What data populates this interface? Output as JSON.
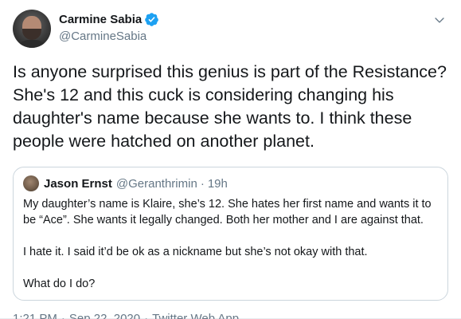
{
  "tweet": {
    "author": {
      "display_name": "Carmine Sabia",
      "handle": "@CarmineSabia",
      "verified": true,
      "verified_color": "#1da1f2"
    },
    "text": "Is anyone surprised this genius is part of the Resistance? She's 12 and this cuck is considering changing his daughter's name because she wants to. I think these people were hatched on another planet.",
    "quoted": {
      "display_name": "Jason Ernst",
      "handle": "@Geranthrimin",
      "dot": "·",
      "time": "19h",
      "paragraphs": [
        "My daughter’s name is Klaire, she’s 12. She hates her first name and wants it to be “Ace”. She wants it legally changed. Both her mother and I are against that.",
        "I hate it. I said it’d be ok as a nickname but she’s not okay with that.",
        "What do I do?"
      ]
    },
    "meta": {
      "time": "1:21 PM",
      "date": "Sep 22, 2020",
      "source": "Twitter Web App",
      "separator": "·"
    }
  },
  "icons": {
    "menu": "chevron-down-icon",
    "verified": "verified-badge-icon"
  },
  "colors": {
    "text": "#14171a",
    "secondary": "#657786",
    "border": "#ccd6dd",
    "accent": "#1da1f2"
  }
}
